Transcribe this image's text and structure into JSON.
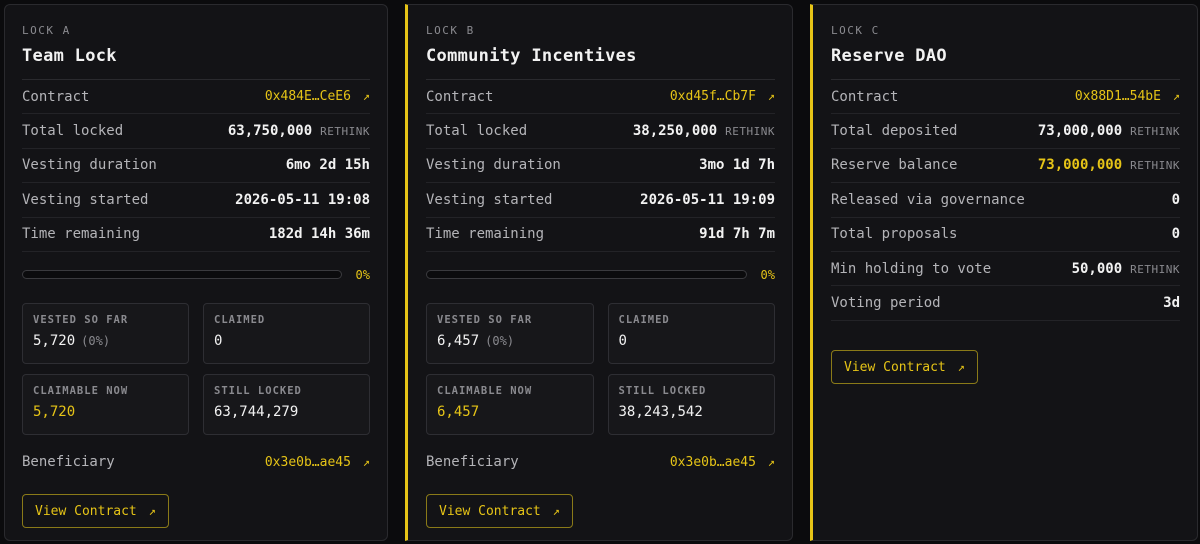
{
  "locks": [
    {
      "tag": "LOCK A",
      "title": "Team Lock",
      "contract_label": "Contract",
      "contract": "0x484E…CeE6",
      "rows": [
        {
          "label": "Total locked",
          "value": "63,750,000",
          "unit": "RETHINK"
        },
        {
          "label": "Vesting duration",
          "value": "6mo 2d 15h"
        },
        {
          "label": "Vesting started",
          "value": "2026-05-11 19:08"
        },
        {
          "label": "Time remaining",
          "value": "182d 14h 36m"
        }
      ],
      "progress": {
        "percent": 0,
        "label": "0%"
      },
      "stats": {
        "vested_label": "VESTED SO FAR",
        "vested": "5,720",
        "vested_pct": "(0%)",
        "claimed_label": "CLAIMED",
        "claimed": "0",
        "claimable_label": "CLAIMABLE NOW",
        "claimable": "5,720",
        "locked_label": "STILL LOCKED",
        "locked": "63,744,279"
      },
      "beneficiary_label": "Beneficiary",
      "beneficiary": "0x3e0b…ae45",
      "button": "View Contract"
    },
    {
      "tag": "LOCK B",
      "title": "Community Incentives",
      "contract_label": "Contract",
      "contract": "0xd45f…Cb7F",
      "rows": [
        {
          "label": "Total locked",
          "value": "38,250,000",
          "unit": "RETHINK"
        },
        {
          "label": "Vesting duration",
          "value": "3mo 1d 7h"
        },
        {
          "label": "Vesting started",
          "value": "2026-05-11 19:09"
        },
        {
          "label": "Time remaining",
          "value": "91d 7h 7m"
        }
      ],
      "progress": {
        "percent": 0,
        "label": "0%"
      },
      "stats": {
        "vested_label": "VESTED SO FAR",
        "vested": "6,457",
        "vested_pct": "(0%)",
        "claimed_label": "CLAIMED",
        "claimed": "0",
        "claimable_label": "CLAIMABLE NOW",
        "claimable": "6,457",
        "locked_label": "STILL LOCKED",
        "locked": "38,243,542"
      },
      "beneficiary_label": "Beneficiary",
      "beneficiary": "0x3e0b…ae45",
      "button": "View Contract"
    },
    {
      "tag": "LOCK C",
      "title": "Reserve DAO",
      "contract_label": "Contract",
      "contract": "0x88D1…54bE",
      "rows": [
        {
          "label": "Total deposited",
          "value": "73,000,000",
          "unit": "RETHINK"
        },
        {
          "label": "Reserve balance",
          "value": "73,000,000",
          "unit": "RETHINK"
        },
        {
          "label": "Released via governance",
          "value": "0"
        },
        {
          "label": "Total proposals",
          "value": "0"
        },
        {
          "label": "Min holding to vote",
          "value": "50,000",
          "unit": "RETHINK"
        },
        {
          "label": "Voting period",
          "value": "3d"
        }
      ],
      "button": "View Contract"
    }
  ],
  "arrow_glyph": "↗",
  "colors": {
    "accent": "#e6c417",
    "card_bg": "#131316",
    "page_bg": "#0b0b0d"
  }
}
